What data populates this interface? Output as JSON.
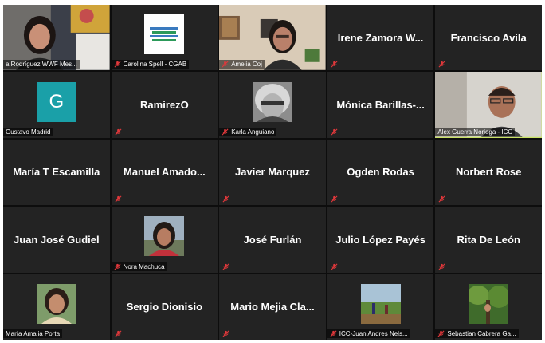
{
  "participants": [
    {
      "name": "a Rodríguez WWF Mes...",
      "type": "video",
      "muted": false
    },
    {
      "name": "Carolina Spell - CGAB",
      "type": "logo",
      "muted": true
    },
    {
      "name": "Amelia Coj",
      "type": "video",
      "muted": true
    },
    {
      "name": "Irene Zamora W...",
      "type": "text",
      "muted": true
    },
    {
      "name": "Francisco Avila",
      "type": "text",
      "muted": true
    },
    {
      "name": "Gustavo Madrid",
      "type": "avatar",
      "avatar_letter": "G",
      "muted": false
    },
    {
      "name": "RamirezO",
      "type": "text",
      "muted": true
    },
    {
      "name": "Karla Anguiano",
      "type": "photo",
      "muted": true
    },
    {
      "name": "Mónica Barillas-...",
      "type": "text",
      "muted": true
    },
    {
      "name": "Alex Guerra Noriega - ICC",
      "type": "video",
      "muted": false,
      "active_speaker": true
    },
    {
      "name": "María T Escamilla",
      "type": "text",
      "muted": false
    },
    {
      "name": "Manuel Amado...",
      "type": "text",
      "muted": true
    },
    {
      "name": "Javier Marquez",
      "type": "text",
      "muted": true
    },
    {
      "name": "Ogden Rodas",
      "type": "text",
      "muted": true
    },
    {
      "name": "Norbert Rose",
      "type": "text",
      "muted": true
    },
    {
      "name": "Juan José Gudiel",
      "type": "text",
      "muted": false
    },
    {
      "name": "Nora Machuca",
      "type": "photo",
      "muted": true
    },
    {
      "name": "José Furlán",
      "type": "text",
      "muted": true
    },
    {
      "name": "Julio López Payés",
      "type": "text",
      "muted": true
    },
    {
      "name": "Rita De León",
      "type": "text",
      "muted": true
    },
    {
      "name": "María Amalia Porta",
      "type": "photo",
      "muted": false
    },
    {
      "name": "Sergio Dionisio",
      "type": "text",
      "muted": true
    },
    {
      "name": "Mario Mejia Cla...",
      "type": "text",
      "muted": true
    },
    {
      "name": "ICC-Juan Andres Nels...",
      "type": "photo",
      "muted": true
    },
    {
      "name": "Sebastian Cabrera Ga...",
      "type": "photo",
      "muted": true
    }
  ],
  "colors": {
    "speaker_outline": "#c9e265",
    "mute_icon": "#e0383b",
    "avatar_bg": "#1aa0a8"
  }
}
